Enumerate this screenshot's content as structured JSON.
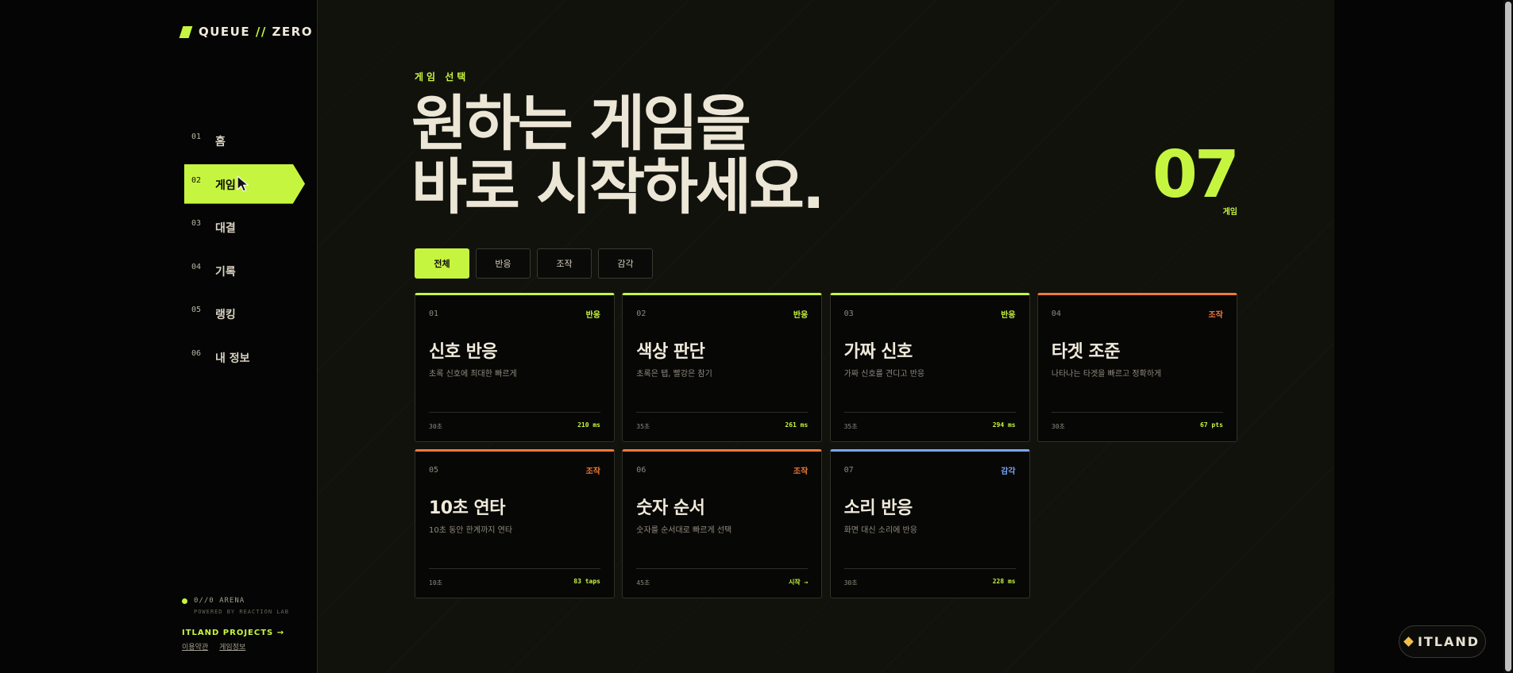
{
  "brand": {
    "name_left": "QUEUE",
    "slash": "//",
    "name_right": "ZERO"
  },
  "nav": [
    {
      "num": "01",
      "label": "홈"
    },
    {
      "num": "02",
      "label": "게임",
      "active": true
    },
    {
      "num": "03",
      "label": "대결"
    },
    {
      "num": "04",
      "label": "기록"
    },
    {
      "num": "05",
      "label": "랭킹"
    },
    {
      "num": "06",
      "label": "내 정보"
    }
  ],
  "footer": {
    "status": "0//0 ARENA",
    "powered": "POWERED BY REACTION LAB",
    "projects": "ITLAND PROJECTS →",
    "terms": "이용약관",
    "info": "게임정보"
  },
  "hero": {
    "eyebrow": "게임 선택",
    "line1": "원하는 게임을",
    "line2": "바로 시작하세요.",
    "count": "07",
    "count_label": "게임"
  },
  "filters": [
    "전체",
    "반응",
    "조작",
    "감각"
  ],
  "colors": {
    "accent": "#c6f53f",
    "reaction": "#c6f53f",
    "control": "#f07a3a",
    "sense": "#7aa7f5"
  },
  "games": [
    {
      "num": "01",
      "category": "반응",
      "title": "신호 반응",
      "desc": "초록 신호에 최대한 빠르게",
      "time": "30초",
      "best": "210 ms",
      "color": "#c6f53f"
    },
    {
      "num": "02",
      "category": "반응",
      "title": "색상 판단",
      "desc": "초록은 탭, 빨강은 참기",
      "time": "35초",
      "best": "261 ms",
      "color": "#c6f53f"
    },
    {
      "num": "03",
      "category": "반응",
      "title": "가짜 신호",
      "desc": "가짜 신호를 견디고 반응",
      "time": "35초",
      "best": "294 ms",
      "color": "#c6f53f"
    },
    {
      "num": "04",
      "category": "조작",
      "title": "타겟 조준",
      "desc": "나타나는 타겟을 빠르고 정확하게",
      "time": "30초",
      "best": "67 pts",
      "color": "#f07a3a"
    },
    {
      "num": "05",
      "category": "조작",
      "title": "10초 연타",
      "desc": "10초 동안 한계까지 연타",
      "time": "10초",
      "best": "83 taps",
      "color": "#f07a3a"
    },
    {
      "num": "06",
      "category": "조작",
      "title": "숫자 순서",
      "desc": "숫자를 순서대로 빠르게 선택",
      "time": "45초",
      "best": "시작 →",
      "color": "#f07a3a"
    },
    {
      "num": "07",
      "category": "감각",
      "title": "소리 반응",
      "desc": "화면 대신 소리에 반응",
      "time": "30초",
      "best": "228 ms",
      "color": "#7aa7f5"
    }
  ],
  "badge": {
    "label": "ITLAND"
  }
}
